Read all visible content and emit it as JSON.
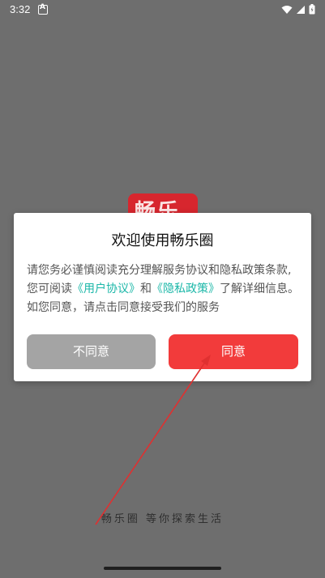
{
  "status_bar": {
    "time": "3:32"
  },
  "splash": {
    "logo_text": "畅乐",
    "slogan": "畅乐圈 等你探索生活"
  },
  "dialog": {
    "title": "欢迎使用畅乐圈",
    "body_pre": "请您务必谨慎阅读充分理解服务协议和隐私政策条款,您可阅读",
    "user_agreement_link": "《用户协议》",
    "and": "和",
    "privacy_policy_link": "《隐私政策》",
    "body_post": "了解详细信息。如您同意，请点击同意接受我们的服务",
    "disagree_label": "不同意",
    "agree_label": "同意"
  },
  "colors": {
    "overlay": "#6e6e6e",
    "accent_red": "#f23b3b",
    "link_teal": "#1bb7a8",
    "disabled_gray": "#a4a4a4"
  }
}
